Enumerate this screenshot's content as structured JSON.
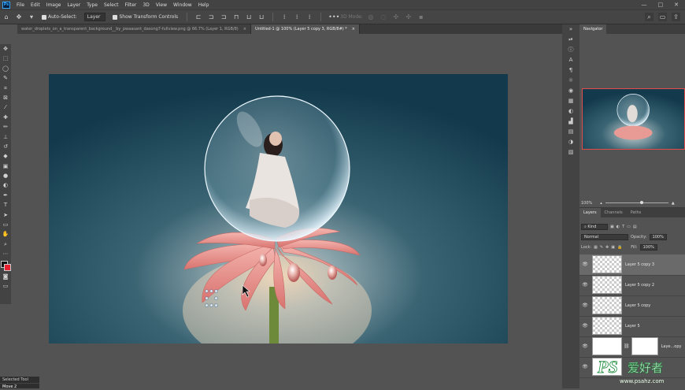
{
  "menu": {
    "app_logo": "Ps",
    "items": [
      "File",
      "Edit",
      "Image",
      "Layer",
      "Type",
      "Select",
      "Filter",
      "3D",
      "View",
      "Window",
      "Help"
    ],
    "window_buttons": [
      "—",
      "□",
      "✕"
    ]
  },
  "options_bar": {
    "auto_select_label": "Auto-Select:",
    "auto_select_value": "Layer",
    "show_transform_label": "Show Transform Controls",
    "mode_3d_label": "3D Mode:"
  },
  "tabs": [
    {
      "label": "water_droplets_on_a_transparent_background__by_pwaasant_dasong7-fullview.png @ 66.7% (Layer 1, RGB/8)",
      "close": "×"
    },
    {
      "label": "Untitled-1 @ 100% (Layer 5 copy 3, RGB/8#) *",
      "close": "×"
    }
  ],
  "tools": [
    "move",
    "artboard",
    "marquee",
    "lasso",
    "quick-select",
    "crop",
    "frame",
    "eyedropper",
    "healing",
    "brush",
    "stamp",
    "history-brush",
    "eraser",
    "gradient",
    "blur",
    "dodge",
    "pen",
    "type",
    "path-select",
    "shape",
    "hand",
    "zoom",
    "more"
  ],
  "navigator": {
    "tab_label": "Navigator",
    "zoom_value": "100%"
  },
  "layers_panel": {
    "tabs": [
      "Layers",
      "Channels",
      "Paths"
    ],
    "kind_label": "Kind",
    "blend_mode": "Normal",
    "opacity_label": "Opacity:",
    "opacity_value": "100%",
    "lock_label": "Lock:",
    "fill_label": "Fill:",
    "fill_value": "100%",
    "layers": [
      {
        "name": "Layer 5 copy 3",
        "selected": true
      },
      {
        "name": "Layer 5 copy 2",
        "selected": false
      },
      {
        "name": "Layer 5 copy",
        "selected": false
      },
      {
        "name": "Layer 5",
        "selected": false
      },
      {
        "name": "Laye...opy",
        "selected": false
      },
      {
        "name": "",
        "selected": false
      }
    ]
  },
  "status": {
    "title": "Selected Tool",
    "value": "Move 2"
  },
  "watermark": {
    "brand": "PS",
    "chinese": "爱好者",
    "url": "www.psahz.com"
  },
  "colors": {
    "foreground": "#111111",
    "background_color": "#e82030",
    "accent": "#31a8ff",
    "nav_highlight": "#e04c4c"
  }
}
